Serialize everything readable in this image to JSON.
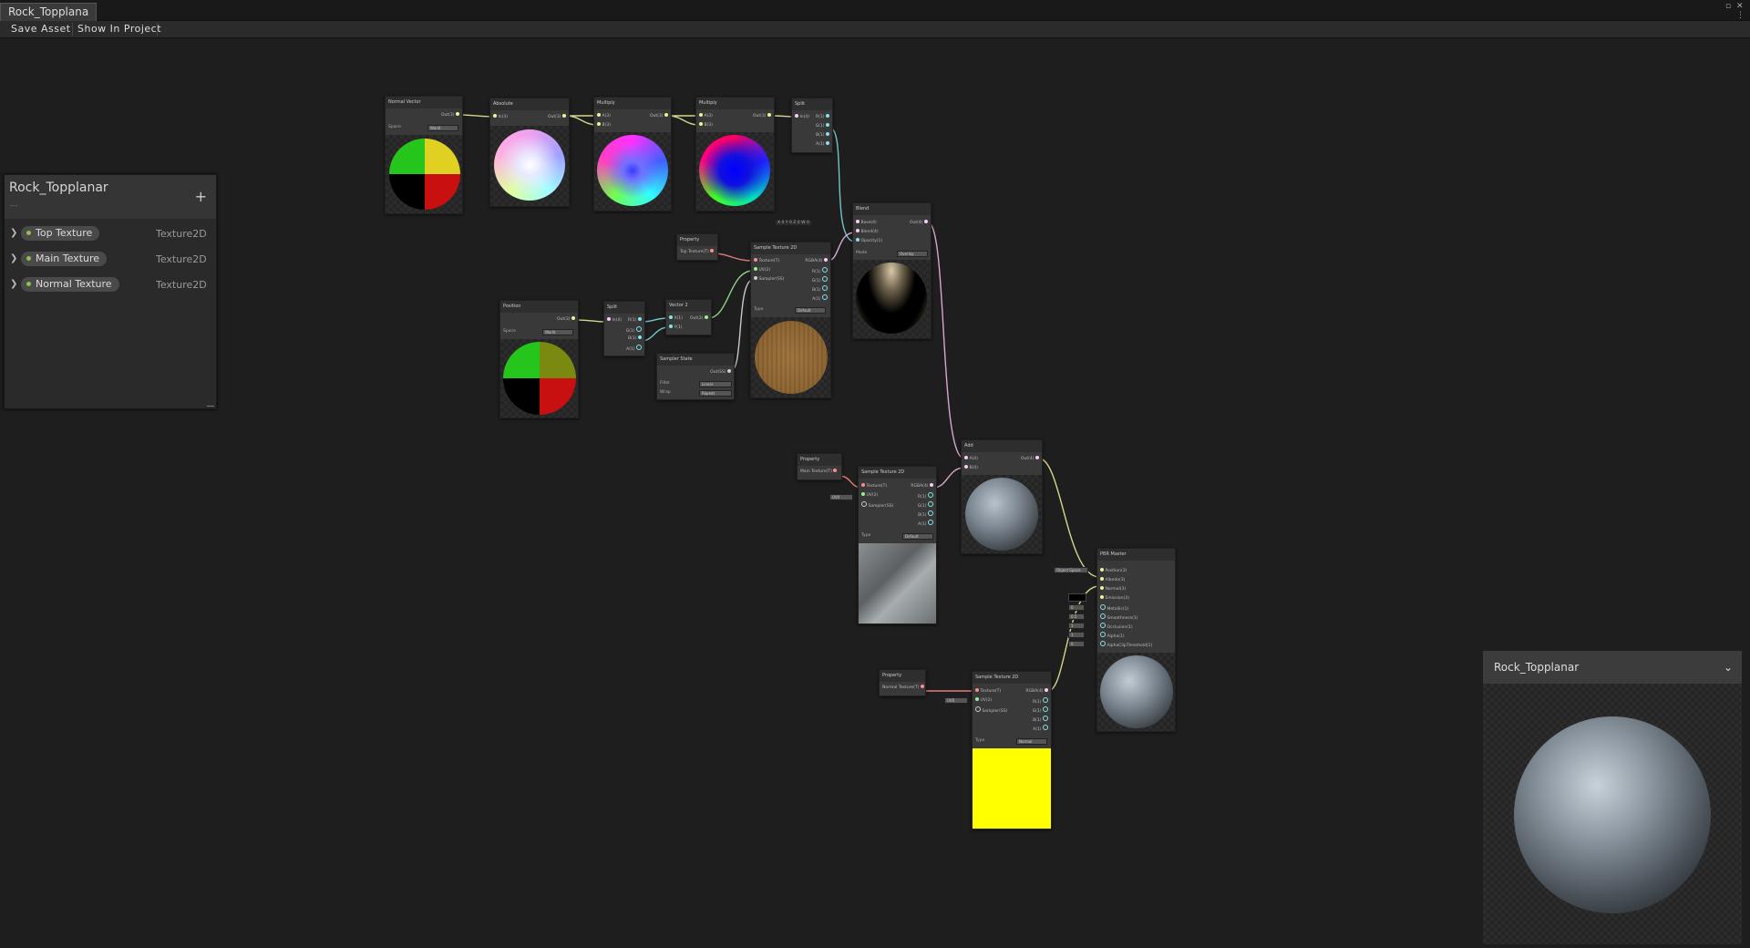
{
  "window": {
    "tab_title": "Rock_Topplana",
    "controls": [
      "▫",
      "✕",
      "⋮"
    ]
  },
  "toolbar": {
    "save_asset": "Save Asset",
    "show_in_project": "Show In Project"
  },
  "blackboard": {
    "title": "Rock_Topplanar",
    "subtitle": "---",
    "add_icon": "+",
    "properties": [
      {
        "name": "Top Texture",
        "type": "Texture2D"
      },
      {
        "name": "Main Texture",
        "type": "Texture2D"
      },
      {
        "name": "Normal Texture",
        "type": "Texture2D"
      }
    ]
  },
  "nodes": {
    "normal_vector": {
      "title": "Normal Vector",
      "out": "Out(3)",
      "space_label": "Space",
      "space_value": "World"
    },
    "absolute": {
      "title": "Absolute",
      "in": "In(3)",
      "out": "Out(3)"
    },
    "multiply1": {
      "title": "Multiply",
      "a": "A(3)",
      "b": "B(3)",
      "out": "Out(3)"
    },
    "multiply2": {
      "title": "Multiply",
      "a": "A(3)",
      "b": "B(3)",
      "out": "Out(3)"
    },
    "split1": {
      "title": "Split",
      "in": "In(4)",
      "r": "R(1)",
      "g": "G(1)",
      "b": "B(1)",
      "a": "A(1)"
    },
    "blend": {
      "title": "Blend",
      "base": "Base(4)",
      "blend_in": "Blend(4)",
      "opacity": "Opacity(1)",
      "out": "Out(4)",
      "mode_label": "Mode",
      "mode_value": "Overlay",
      "vec": "X 0   Y 0   Z 0   W 0"
    },
    "property_top": {
      "title": "Property",
      "label": "Top Texture(T)"
    },
    "sample_top": {
      "title": "Sample Texture 2D",
      "texture": "Texture(T)",
      "uv": "UV(2)",
      "sampler": "Sampler(SS)",
      "rgba": "RGBA(4)",
      "r": "R(1)",
      "g": "G(1)",
      "b": "B(1)",
      "a": "A(1)",
      "type_label": "Type",
      "type_value": "Default"
    },
    "position": {
      "title": "Position",
      "out": "Out(3)",
      "space_label": "Space",
      "space_value": "World"
    },
    "split2": {
      "title": "Split",
      "in": "In(4)",
      "r": "R(1)",
      "g": "G(1)",
      "b": "B(1)",
      "a": "A(1)"
    },
    "vector2": {
      "title": "Vector 2",
      "x": "X(1)",
      "y": "Y(1)",
      "out": "Out(2)"
    },
    "sampler_state": {
      "title": "Sampler State",
      "out": "Out(SS)",
      "filter_label": "Filter",
      "filter_value": "Linear",
      "wrap_label": "Wrap",
      "wrap_value": "Repeat"
    },
    "add": {
      "title": "Add",
      "a": "A(4)",
      "b": "B(4)",
      "out": "Out(4)"
    },
    "property_main": {
      "title": "Property",
      "label": "Main Texture(T)"
    },
    "sample_main": {
      "title": "Sample Texture 2D",
      "texture": "Texture(T)",
      "uv": "UV(2)",
      "sampler": "Sampler(SS)",
      "rgba": "RGBA(4)",
      "r": "R(1)",
      "g": "G(1)",
      "b": "B(1)",
      "a": "A(1)",
      "type_label": "Type",
      "type_value": "Default",
      "uv_default": "UV0"
    },
    "pbr": {
      "title": "PBR Master",
      "object_space": "Object Space",
      "inputs": [
        "Position(3)",
        "Albedo(3)",
        "Normal(3)",
        "Emission(3)",
        "Metallic(1)",
        "Smoothness(1)",
        "Occlusion(1)",
        "Alpha(1)",
        "AlphaClipThreshold(1)"
      ],
      "values": [
        "0",
        "0.5",
        "1",
        "1",
        "0"
      ]
    },
    "property_normal": {
      "title": "Property",
      "label": "Normal Texture(T)"
    },
    "sample_normal": {
      "title": "Sample Texture 2D",
      "texture": "Texture(T)",
      "uv": "UV(2)",
      "sampler": "Sampler(SS)",
      "rgba": "RGBA(4)",
      "r": "R(1)",
      "g": "G(1)",
      "b": "B(1)",
      "a": "A(1)",
      "type_label": "Type",
      "type_value": "Normal",
      "uv_default": "UV0"
    }
  },
  "main_preview": {
    "title": "Rock_Topplanar",
    "chevron": "⌄"
  },
  "colors": {
    "vec3_port": "#f0f29a",
    "vec4_port": "#fbcbf4",
    "vec1_port": "#84e4e7",
    "vec2_port": "#9aef92",
    "texture_port": "#ff8b8b",
    "wire_yellow": "#d6d78a",
    "wire_teal": "#6fc6c9",
    "wire_pink": "#d8a7cf",
    "wire_green": "#8fcf88",
    "wire_red": "#e07b7b"
  }
}
